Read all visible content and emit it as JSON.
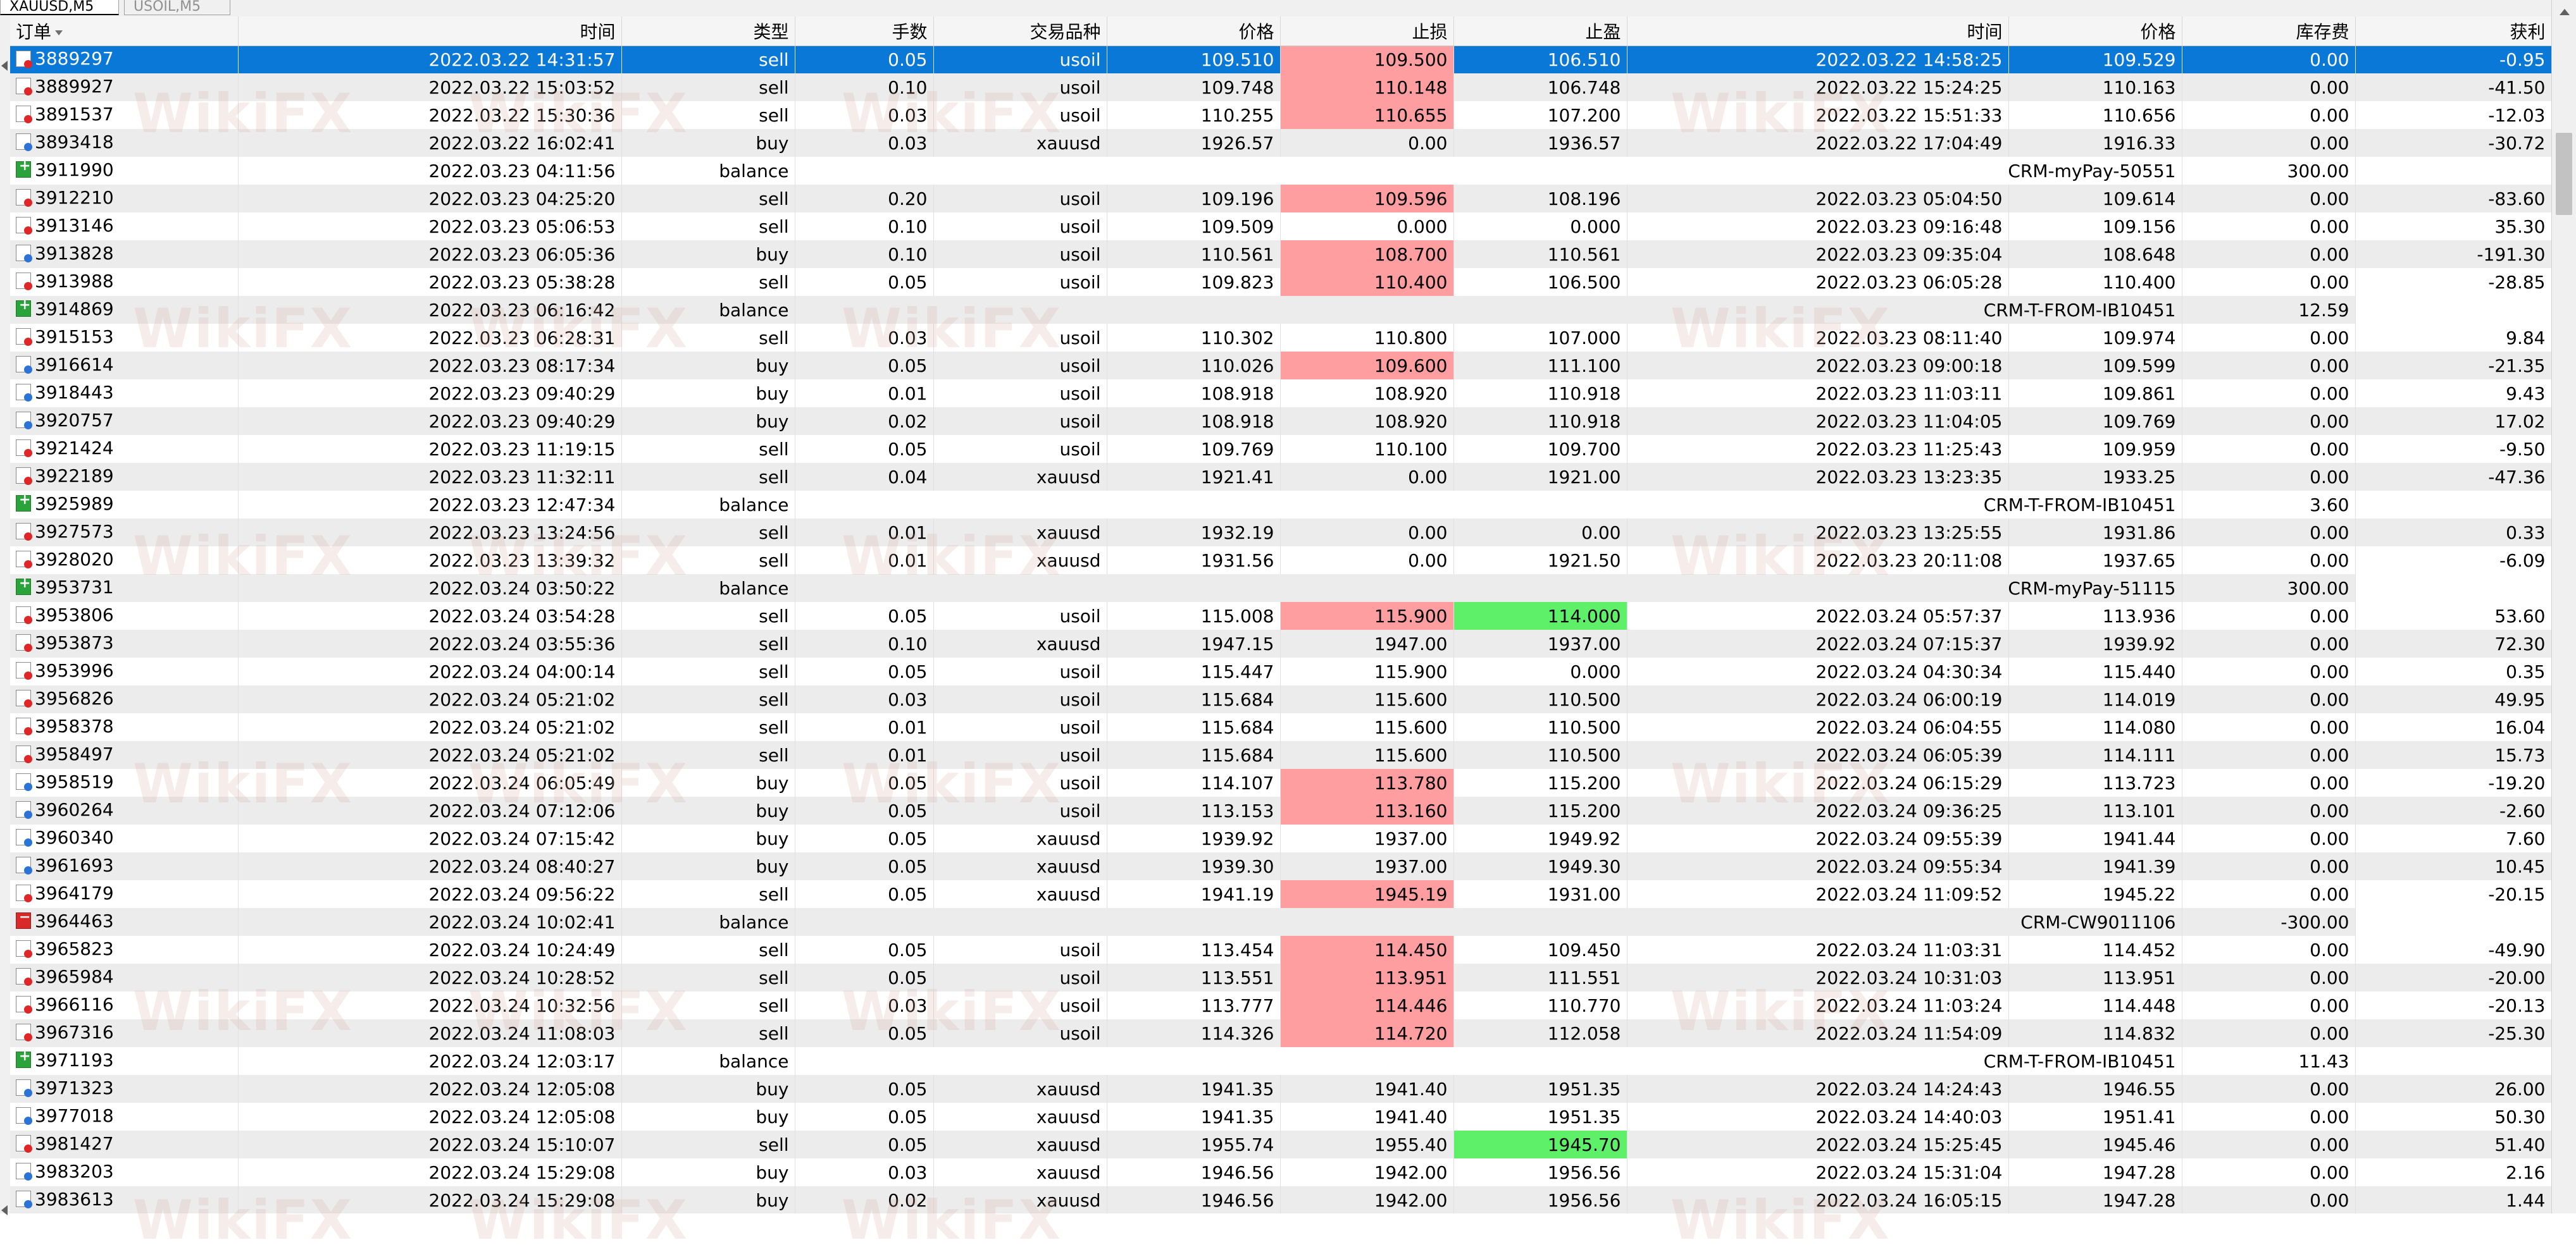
{
  "tabs": [
    {
      "label": "XAUUSD,M5",
      "active": true
    },
    {
      "label": "USOIL,M5",
      "active": false
    }
  ],
  "watermark_text": "WikiFX",
  "columns": [
    "订单",
    "时间",
    "类型",
    "手数",
    "交易品种",
    "价格",
    "止损",
    "止盈",
    "时间",
    "价格",
    "库存费",
    "获利"
  ],
  "rows": [
    [
      "3889297",
      "2022.03.22 14:31:57",
      "sell",
      "0.05",
      "usoil",
      "109.510",
      "109.500",
      "106.510",
      "2022.03.22 14:58:25",
      "109.529",
      "0.00",
      "-0.95"
    ],
    [
      "3889927",
      "2022.03.22 15:03:52",
      "sell",
      "0.10",
      "usoil",
      "109.748",
      "110.148",
      "106.748",
      "2022.03.22 15:24:25",
      "110.163",
      "0.00",
      "-41.50"
    ],
    [
      "3891537",
      "2022.03.22 15:30:36",
      "sell",
      "0.03",
      "usoil",
      "110.255",
      "110.655",
      "107.200",
      "2022.03.22 15:51:33",
      "110.656",
      "0.00",
      "-12.03"
    ],
    [
      "3893418",
      "2022.03.22 16:02:41",
      "buy",
      "0.03",
      "xauusd",
      "1926.57",
      "0.00",
      "1936.57",
      "2022.03.22 17:04:49",
      "1916.33",
      "0.00",
      "-30.72"
    ],
    [
      "3911990",
      "2022.03.23 04:11:56",
      "balance",
      "",
      "",
      "",
      "",
      "",
      "",
      "CRM-myPay-50551",
      "",
      "300.00"
    ],
    [
      "3912210",
      "2022.03.23 04:25:20",
      "sell",
      "0.20",
      "usoil",
      "109.196",
      "109.596",
      "108.196",
      "2022.03.23 05:04:50",
      "109.614",
      "0.00",
      "-83.60"
    ],
    [
      "3913146",
      "2022.03.23 05:06:53",
      "sell",
      "0.10",
      "usoil",
      "109.509",
      "0.000",
      "0.000",
      "2022.03.23 09:16:48",
      "109.156",
      "0.00",
      "35.30"
    ],
    [
      "3913828",
      "2022.03.23 06:05:36",
      "buy",
      "0.10",
      "usoil",
      "110.561",
      "108.700",
      "110.561",
      "2022.03.23 09:35:04",
      "108.648",
      "0.00",
      "-191.30"
    ],
    [
      "3913988",
      "2022.03.23 05:38:28",
      "sell",
      "0.05",
      "usoil",
      "109.823",
      "110.400",
      "106.500",
      "2022.03.23 06:05:28",
      "110.400",
      "0.00",
      "-28.85"
    ],
    [
      "3914869",
      "2022.03.23 06:16:42",
      "balance",
      "",
      "",
      "",
      "",
      "",
      "",
      "CRM-T-FROM-IB10451",
      "",
      "12.59"
    ],
    [
      "3915153",
      "2022.03.23 06:28:31",
      "sell",
      "0.03",
      "usoil",
      "110.302",
      "110.800",
      "107.000",
      "2022.03.23 08:11:40",
      "109.974",
      "0.00",
      "9.84"
    ],
    [
      "3916614",
      "2022.03.23 08:17:34",
      "buy",
      "0.05",
      "usoil",
      "110.026",
      "109.600",
      "111.100",
      "2022.03.23 09:00:18",
      "109.599",
      "0.00",
      "-21.35"
    ],
    [
      "3918443",
      "2022.03.23 09:40:29",
      "buy",
      "0.01",
      "usoil",
      "108.918",
      "108.920",
      "110.918",
      "2022.03.23 11:03:11",
      "109.861",
      "0.00",
      "9.43"
    ],
    [
      "3920757",
      "2022.03.23 09:40:29",
      "buy",
      "0.02",
      "usoil",
      "108.918",
      "108.920",
      "110.918",
      "2022.03.23 11:04:05",
      "109.769",
      "0.00",
      "17.02"
    ],
    [
      "3921424",
      "2022.03.23 11:19:15",
      "sell",
      "0.05",
      "usoil",
      "109.769",
      "110.100",
      "109.700",
      "2022.03.23 11:25:43",
      "109.959",
      "0.00",
      "-9.50"
    ],
    [
      "3922189",
      "2022.03.23 11:32:11",
      "sell",
      "0.04",
      "xauusd",
      "1921.41",
      "0.00",
      "1921.00",
      "2022.03.23 13:23:35",
      "1933.25",
      "0.00",
      "-47.36"
    ],
    [
      "3925989",
      "2022.03.23 12:47:34",
      "balance",
      "",
      "",
      "",
      "",
      "",
      "",
      "CRM-T-FROM-IB10451",
      "",
      "3.60"
    ],
    [
      "3927573",
      "2022.03.23 13:24:56",
      "sell",
      "0.01",
      "xauusd",
      "1932.19",
      "0.00",
      "0.00",
      "2022.03.23 13:25:55",
      "1931.86",
      "0.00",
      "0.33"
    ],
    [
      "3928020",
      "2022.03.23 13:39:32",
      "sell",
      "0.01",
      "xauusd",
      "1931.56",
      "0.00",
      "1921.50",
      "2022.03.23 20:11:08",
      "1937.65",
      "0.00",
      "-6.09"
    ],
    [
      "3953731",
      "2022.03.24 03:50:22",
      "balance",
      "",
      "",
      "",
      "",
      "",
      "",
      "CRM-myPay-51115",
      "",
      "300.00"
    ],
    [
      "3953806",
      "2022.03.24 03:54:28",
      "sell",
      "0.05",
      "usoil",
      "115.008",
      "115.900",
      "114.000",
      "2022.03.24 05:57:37",
      "113.936",
      "0.00",
      "53.60"
    ],
    [
      "3953873",
      "2022.03.24 03:55:36",
      "sell",
      "0.10",
      "xauusd",
      "1947.15",
      "1947.00",
      "1937.00",
      "2022.03.24 07:15:37",
      "1939.92",
      "0.00",
      "72.30"
    ],
    [
      "3953996",
      "2022.03.24 04:00:14",
      "sell",
      "0.05",
      "usoil",
      "115.447",
      "115.900",
      "0.000",
      "2022.03.24 04:30:34",
      "115.440",
      "0.00",
      "0.35"
    ],
    [
      "3956826",
      "2022.03.24 05:21:02",
      "sell",
      "0.03",
      "usoil",
      "115.684",
      "115.600",
      "110.500",
      "2022.03.24 06:00:19",
      "114.019",
      "0.00",
      "49.95"
    ],
    [
      "3958378",
      "2022.03.24 05:21:02",
      "sell",
      "0.01",
      "usoil",
      "115.684",
      "115.600",
      "110.500",
      "2022.03.24 06:04:55",
      "114.080",
      "0.00",
      "16.04"
    ],
    [
      "3958497",
      "2022.03.24 05:21:02",
      "sell",
      "0.01",
      "usoil",
      "115.684",
      "115.600",
      "110.500",
      "2022.03.24 06:05:39",
      "114.111",
      "0.00",
      "15.73"
    ],
    [
      "3958519",
      "2022.03.24 06:05:49",
      "buy",
      "0.05",
      "usoil",
      "114.107",
      "113.780",
      "115.200",
      "2022.03.24 06:15:29",
      "113.723",
      "0.00",
      "-19.20"
    ],
    [
      "3960264",
      "2022.03.24 07:12:06",
      "buy",
      "0.05",
      "usoil",
      "113.153",
      "113.160",
      "115.200",
      "2022.03.24 09:36:25",
      "113.101",
      "0.00",
      "-2.60"
    ],
    [
      "3960340",
      "2022.03.24 07:15:42",
      "buy",
      "0.05",
      "xauusd",
      "1939.92",
      "1937.00",
      "1949.92",
      "2022.03.24 09:55:39",
      "1941.44",
      "0.00",
      "7.60"
    ],
    [
      "3961693",
      "2022.03.24 08:40:27",
      "buy",
      "0.05",
      "xauusd",
      "1939.30",
      "1937.00",
      "1949.30",
      "2022.03.24 09:55:34",
      "1941.39",
      "0.00",
      "10.45"
    ],
    [
      "3964179",
      "2022.03.24 09:56:22",
      "sell",
      "0.05",
      "xauusd",
      "1941.19",
      "1945.19",
      "1931.00",
      "2022.03.24 11:09:52",
      "1945.22",
      "0.00",
      "-20.15"
    ],
    [
      "3964463",
      "2022.03.24 10:02:41",
      "balance",
      "",
      "",
      "",
      "",
      "",
      "",
      "CRM-CW9011106",
      "",
      "-300.00"
    ],
    [
      "3965823",
      "2022.03.24 10:24:49",
      "sell",
      "0.05",
      "usoil",
      "113.454",
      "114.450",
      "109.450",
      "2022.03.24 11:03:31",
      "114.452",
      "0.00",
      "-49.90"
    ],
    [
      "3965984",
      "2022.03.24 10:28:52",
      "sell",
      "0.05",
      "usoil",
      "113.551",
      "113.951",
      "111.551",
      "2022.03.24 10:31:03",
      "113.951",
      "0.00",
      "-20.00"
    ],
    [
      "3966116",
      "2022.03.24 10:32:56",
      "sell",
      "0.03",
      "usoil",
      "113.777",
      "114.446",
      "110.770",
      "2022.03.24 11:03:24",
      "114.448",
      "0.00",
      "-20.13"
    ],
    [
      "3967316",
      "2022.03.24 11:08:03",
      "sell",
      "0.05",
      "usoil",
      "114.326",
      "114.720",
      "112.058",
      "2022.03.24 11:54:09",
      "114.832",
      "0.00",
      "-25.30"
    ],
    [
      "3971193",
      "2022.03.24 12:03:17",
      "balance",
      "",
      "",
      "",
      "",
      "",
      "",
      "CRM-T-FROM-IB10451",
      "",
      "11.43"
    ],
    [
      "3971323",
      "2022.03.24 12:05:08",
      "buy",
      "0.05",
      "xauusd",
      "1941.35",
      "1941.40",
      "1951.35",
      "2022.03.24 14:24:43",
      "1946.55",
      "0.00",
      "26.00"
    ],
    [
      "3977018",
      "2022.03.24 12:05:08",
      "buy",
      "0.05",
      "xauusd",
      "1941.35",
      "1941.40",
      "1951.35",
      "2022.03.24 14:40:03",
      "1951.41",
      "0.00",
      "50.30"
    ],
    [
      "3981427",
      "2022.03.24 15:10:07",
      "sell",
      "0.05",
      "xauusd",
      "1955.74",
      "1955.40",
      "1945.70",
      "2022.03.24 15:25:45",
      "1945.46",
      "0.00",
      "51.40"
    ],
    [
      "3983203",
      "2022.03.24 15:29:08",
      "buy",
      "0.03",
      "xauusd",
      "1946.56",
      "1942.00",
      "1956.56",
      "2022.03.24 15:31:04",
      "1947.28",
      "0.00",
      "2.16"
    ],
    [
      "3983613",
      "2022.03.24 15:29:08",
      "buy",
      "0.02",
      "xauusd",
      "1946.56",
      "1942.00",
      "1956.56",
      "2022.03.24 16:05:15",
      "1947.28",
      "0.00",
      "1.44"
    ]
  ],
  "sl_hit_rows": [
    0,
    1,
    2,
    5,
    7,
    8,
    11,
    20,
    26,
    27,
    30,
    32,
    33,
    34,
    35
  ],
  "tp_hit_rows": [
    20,
    39
  ],
  "selected_row": 0,
  "colors": {
    "selected": "#0a78d7",
    "sl_hit": "#ff9ea0",
    "tp_hit": "#5ff06a",
    "row_alt": "#ececec"
  }
}
